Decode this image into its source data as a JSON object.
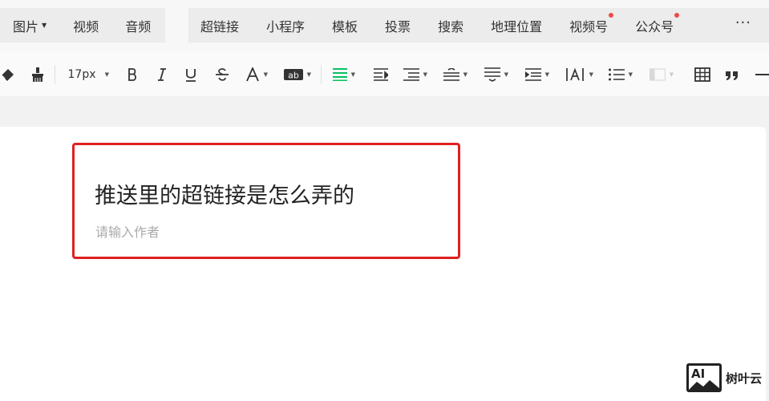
{
  "insert_tabs": {
    "group1": [
      {
        "label": "图片",
        "has_dropdown": true
      },
      {
        "label": "视频"
      },
      {
        "label": "音频"
      }
    ],
    "group2": [
      {
        "label": "超链接"
      },
      {
        "label": "小程序"
      },
      {
        "label": "模板"
      },
      {
        "label": "投票"
      },
      {
        "label": "搜索"
      },
      {
        "label": "地理位置"
      },
      {
        "label": "视频号",
        "badge": "red-dot"
      },
      {
        "label": "公众号",
        "badge": "red-dot"
      }
    ],
    "more_label": "···"
  },
  "toolbar": {
    "font_size": "17px",
    "tools": [
      "clear-format",
      "format-painter",
      "font-size",
      "bold",
      "italic",
      "underline",
      "strikethrough",
      "font-color",
      "background-color",
      "align",
      "indent-first-line",
      "paragraph-spacing",
      "line-spacing",
      "paragraph-spacing-after",
      "indent",
      "letter-spacing",
      "list",
      "border",
      "table",
      "quote",
      "divider"
    ],
    "accent_color": "#07c160"
  },
  "editor": {
    "title": "推送里的超链接是怎么弄的",
    "author_placeholder": "请输入作者",
    "highlight_color": "#e02020"
  },
  "watermark": {
    "logo_text": "AI",
    "brand": "树叶云"
  }
}
